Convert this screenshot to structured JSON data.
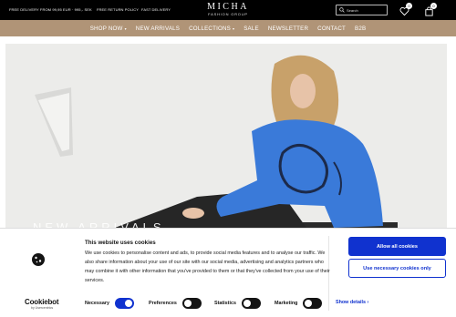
{
  "topbar": {
    "promos": [
      "FREE DELIVERY FROM 99,95 EUR · 995,- SEK",
      "FREE RETURN POLICY",
      "FAST DELIVERY"
    ],
    "logo": {
      "main": "MICHA",
      "sub": "FASHION GROUP"
    },
    "search": {
      "placeholder": "Search"
    },
    "wishlist_count": "0",
    "cart_count": "0"
  },
  "nav": {
    "items": [
      "SHOP NOW",
      "NEW ARRIVALS",
      "COLLECTIONS",
      "SALE",
      "NEWSLETTER",
      "CONTACT",
      "B2B"
    ]
  },
  "hero": {
    "headline": "NEW ARRIVALS"
  },
  "cookie": {
    "brand": "Cookiebot",
    "brand_sub": "by Usercentrics",
    "title": "This website uses cookies",
    "body": "We use cookies to personalise content and ads, to provide social media features and to analyse our traffic. We also share information about your use of our site with our social media, advertising and analytics partners who may combine it with other information that you've provided to them or that they've collected from your use of their services.",
    "allow_label": "Allow all cookies",
    "necessary_label": "Use necessary cookies only",
    "toggles": [
      {
        "label": "Necessary",
        "state": "on"
      },
      {
        "label": "Preferences",
        "state": "off"
      },
      {
        "label": "Statistics",
        "state": "off"
      },
      {
        "label": "Marketing",
        "state": "off"
      }
    ],
    "show_details": "Show details",
    "accent_color": "#1032cf"
  }
}
